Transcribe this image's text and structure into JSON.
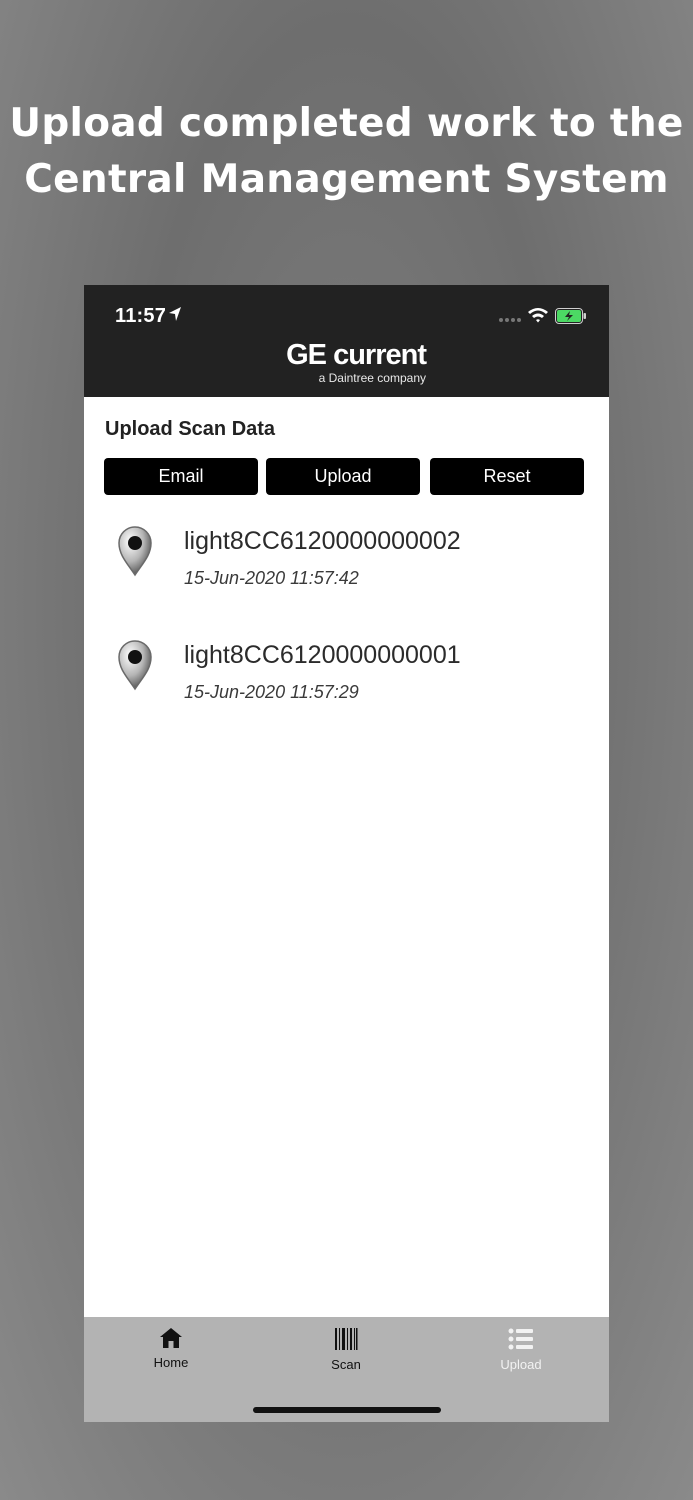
{
  "headline": {
    "line1": "Upload completed work to the",
    "line2": "Central Management System"
  },
  "status_bar": {
    "time": "11:57",
    "icons": [
      "location-arrow-icon",
      "signal-dots-icon",
      "wifi-icon",
      "battery-charging-icon"
    ]
  },
  "brand": {
    "name": "GE current",
    "subtitle": "a Daintree company"
  },
  "page": {
    "title": "Upload Scan Data"
  },
  "actions": {
    "email_label": "Email",
    "upload_label": "Upload",
    "reset_label": "Reset"
  },
  "scans": [
    {
      "id": "light8CC6120000000002",
      "timestamp": "15-Jun-2020 11:57:42",
      "icon": "map-pin-icon"
    },
    {
      "id": "light8CC6120000000001",
      "timestamp": "15-Jun-2020 11:57:29",
      "icon": "map-pin-icon"
    }
  ],
  "tabbar": {
    "active": "Upload",
    "tabs": [
      {
        "label": "Home",
        "icon": "home-icon"
      },
      {
        "label": "Scan",
        "icon": "barcode-icon"
      },
      {
        "label": "Upload",
        "icon": "list-icon"
      }
    ]
  },
  "colors": {
    "header_bg": "#222222",
    "button_bg": "#000000",
    "tabbar_bg": "#b3b3b3",
    "battery_green": "#4cd964"
  }
}
